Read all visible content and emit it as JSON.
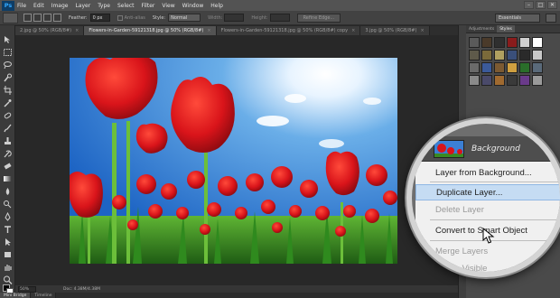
{
  "app": {
    "logo": "Ps"
  },
  "menu": [
    "File",
    "Edit",
    "Image",
    "Layer",
    "Type",
    "Select",
    "Filter",
    "View",
    "Window",
    "Help"
  ],
  "window_controls": [
    "–",
    "□",
    "✕"
  ],
  "options_bar": {
    "feather_label": "Feather:",
    "feather_value": "0 px",
    "antialias_label": "Anti-alias",
    "style_label": "Style:",
    "style_value": "Normal",
    "width_label": "Width:",
    "height_label": "Height:",
    "refine_edge_label": "Refine Edge...",
    "workspace_value": "Essentials"
  },
  "doc_tabs": [
    {
      "label": "2.jpg @ 50% (RGB/8#)",
      "active": false
    },
    {
      "label": "Flowers-in-Garden-59121318.jpg @ 50% (RGB/8#)",
      "active": true
    },
    {
      "label": "Flowers-in-Garden-59121318.jpg @ 50% (RGB/8#) copy",
      "active": false
    },
    {
      "label": "3.jpg @ 50% (RGB/8#)",
      "active": false
    }
  ],
  "tab_close": "×",
  "status": {
    "zoom": "50%",
    "doc": "Doc: 4.38M/4.38M"
  },
  "bottom_tabs": [
    {
      "label": "Mini Bridge",
      "active": true
    },
    {
      "label": "Timeline",
      "active": false
    }
  ],
  "panels": {
    "tabs": [
      {
        "label": "Adjustments",
        "active": false
      },
      {
        "label": "Styles",
        "active": true
      }
    ],
    "style_swatches": [
      "#5a5a5a",
      "#4a3a2a",
      "#2f2f2f",
      "#8a1c1c",
      "#cfcfcf",
      "#ffffff",
      "#5e5a4a",
      "#7a6a3a",
      "#b0a060",
      "#3a4f7a",
      "#2a2a2a",
      "#c8c8c8",
      "#6a6a6a",
      "#3b5a9a",
      "#7c5a32",
      "#d0a040",
      "#2a6e2a",
      "#5a6a7a",
      "#8a8a8a",
      "#4a4a6a",
      "#a06a30",
      "#3a3a3a",
      "#6a3a8a",
      "#9a9a9a"
    ]
  },
  "layers_popup": {
    "layer_name": "Background",
    "items": [
      {
        "label": "Layer from Background...",
        "state": "normal"
      },
      {
        "label": "Duplicate Layer...",
        "state": "highlighted"
      },
      {
        "label": "Delete Layer",
        "state": "disabled"
      },
      {
        "label": "Convert to Smart Object",
        "state": "normal"
      },
      {
        "label": "Merge Layers",
        "state": "disabled"
      },
      {
        "label": "Merge Visible",
        "state": "disabled"
      }
    ]
  }
}
